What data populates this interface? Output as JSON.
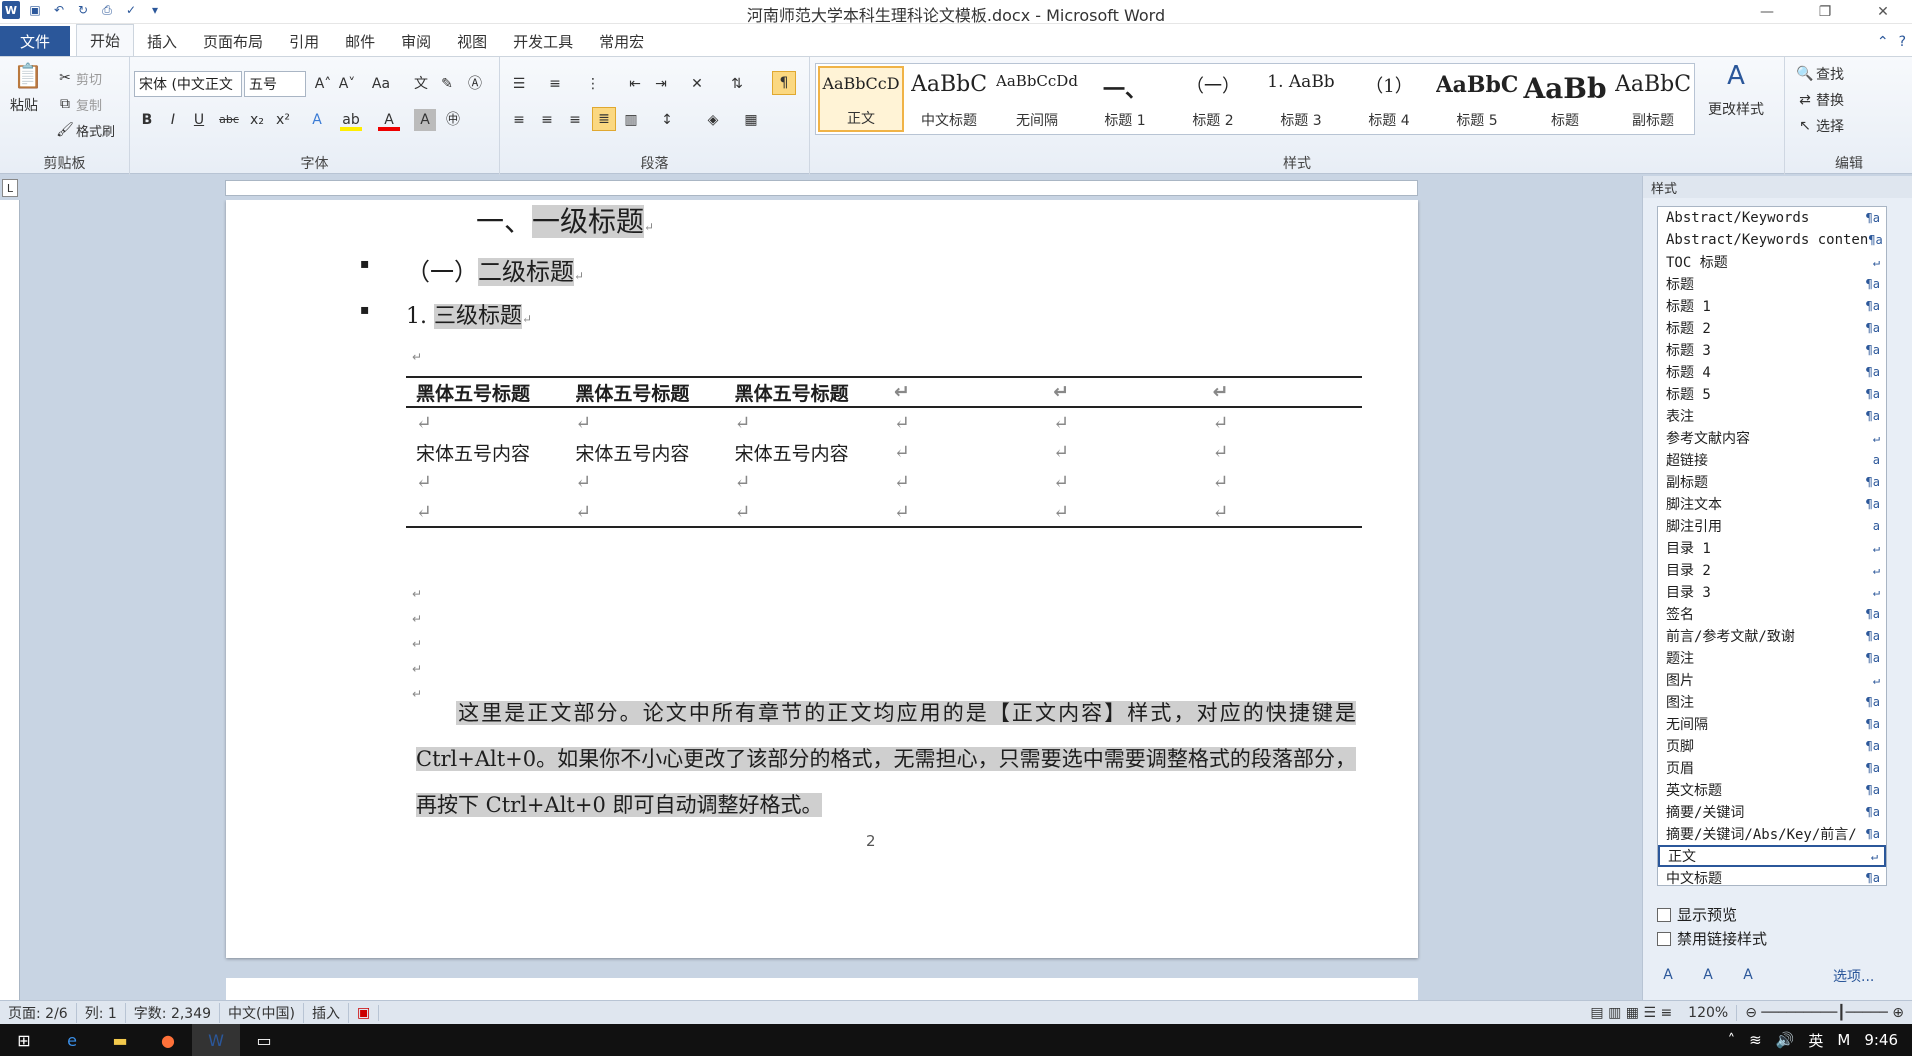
{
  "window": {
    "title": "河南师范大学本科生理科论文模板.docx - Microsoft Word"
  },
  "tabs": [
    "文件",
    "开始",
    "插入",
    "页面布局",
    "引用",
    "邮件",
    "审阅",
    "视图",
    "开发工具",
    "常用宏"
  ],
  "clipboard": {
    "paste": "粘贴",
    "cut": "剪切",
    "copy": "复制",
    "format_painter": "格式刷",
    "label": "剪贴板"
  },
  "font": {
    "name": "宋体 (中文正文",
    "size": "五号",
    "label": "字体"
  },
  "paragraph": {
    "label": "段落"
  },
  "styles": {
    "label": "样式",
    "change": "更改样式",
    "items": [
      {
        "preview": "AaBbCcD",
        "name": "正文"
      },
      {
        "preview": "AaBbC",
        "name": "中文标题"
      },
      {
        "preview": "AaBbCcDd",
        "name": "无间隔"
      },
      {
        "preview": "一、",
        "name": "标题 1"
      },
      {
        "preview": "（一）",
        "name": "标题 2"
      },
      {
        "preview": "1. AaBb",
        "name": "标题 3"
      },
      {
        "preview": "（1）",
        "name": "标题 4"
      },
      {
        "preview": "AaBbC",
        "name": "标题 5"
      },
      {
        "preview": "AaBb",
        "name": "标题"
      },
      {
        "preview": "AaBbC",
        "name": "副标题"
      }
    ]
  },
  "editing": {
    "find": "查找",
    "replace": "替换",
    "select": "选择",
    "label": "编辑"
  },
  "document": {
    "h1": {
      "num": "一、",
      "text": "一级标题"
    },
    "h2": {
      "num": "（一）",
      "text": "二级标题"
    },
    "h3": {
      "num": "1. ",
      "text": "三级标题"
    },
    "table": {
      "header": [
        "黑体五号标题",
        "黑体五号标题",
        "黑体五号标题"
      ],
      "row": [
        "宋体五号内容",
        "宋体五号内容",
        "宋体五号内容"
      ]
    },
    "paragraph": "这里是正文部分。论文中所有章节的正文均应用的是【正文内容】样式，对应的快捷键是 Ctrl+Alt+0。如果你不小心更改了该部分的格式，无需担心，只需要选中需要调整格式的段落部分，再按下 Ctrl+Alt+0 即可自动调整好格式。",
    "page_number": "2"
  },
  "styles_pane": {
    "title": "样式",
    "options": "选项...",
    "show_preview": "显示预览",
    "disable_linked": "禁用链接样式",
    "items": [
      "Abstract/Keywords",
      "Abstract/Keywords conten",
      "TOC 标题",
      "标题",
      "标题 1",
      "标题 2",
      "标题 3",
      "标题 4",
      "标题 5",
      "表注",
      "参考文献内容",
      "超链接",
      "副标题",
      "脚注文本",
      "脚注引用",
      "目录 1",
      "目录 2",
      "目录 3",
      "签名",
      "前言/参考文献/致谢",
      "题注",
      "图片",
      "图注",
      "无间隔",
      "页脚",
      "页眉",
      "英文标题",
      "摘要/关键词",
      "摘要/关键词/Abs/Key/前言/",
      "正文",
      "中文标题"
    ]
  },
  "status": {
    "page": "页面: 2/6",
    "col": "列: 1",
    "words": "字数: 2,349",
    "lang": "中文(中国)",
    "mode": "插入",
    "zoom": "120%"
  },
  "clock": "9:46",
  "tray_lang": "英"
}
